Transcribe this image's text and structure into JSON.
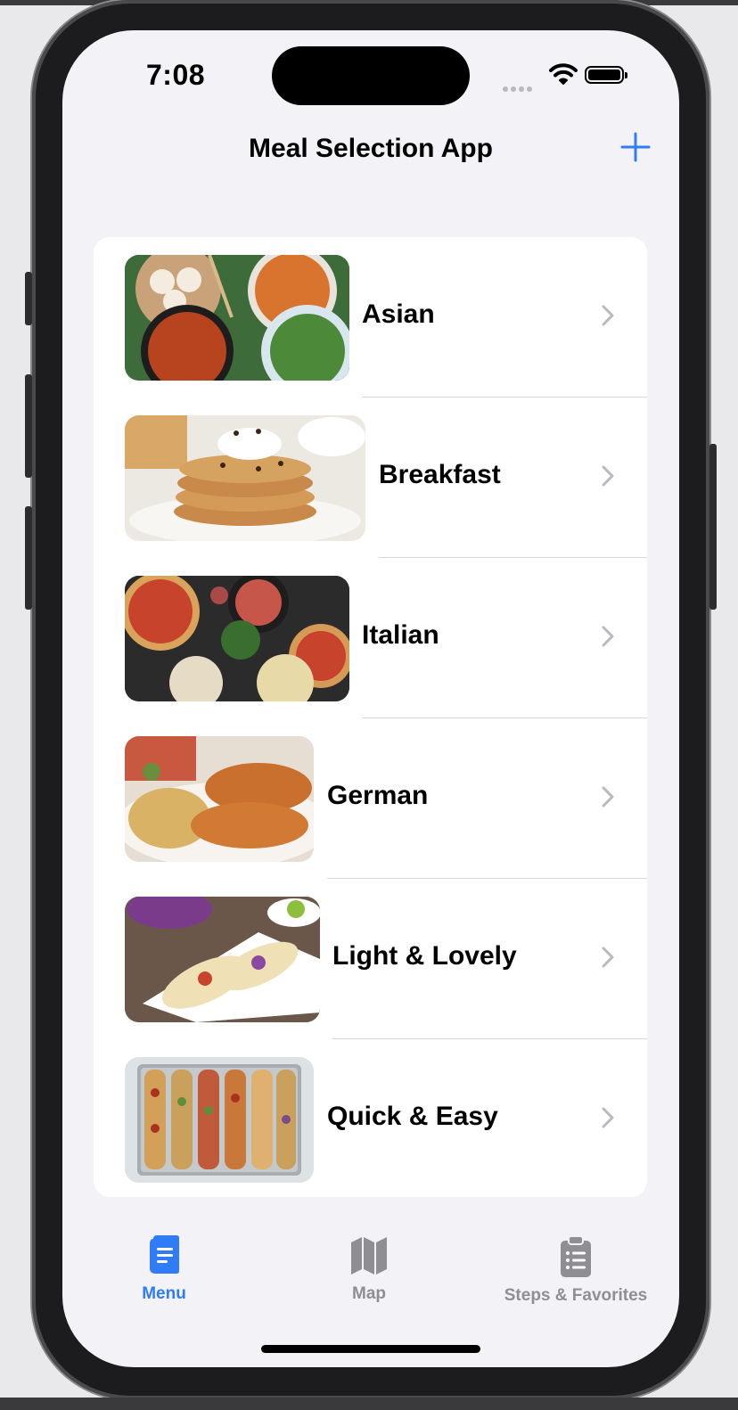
{
  "status_bar": {
    "time": "7:08"
  },
  "nav": {
    "title": "Meal Selection App",
    "add_icon": "plus-icon"
  },
  "categories": [
    {
      "label": "Asian"
    },
    {
      "label": "Breakfast"
    },
    {
      "label": "Italian"
    },
    {
      "label": "German"
    },
    {
      "label": "Light & Lovely"
    },
    {
      "label": "Quick & Easy"
    }
  ],
  "tabs": [
    {
      "label": "Menu",
      "icon": "menu-book-icon",
      "selected": true
    },
    {
      "label": "Map",
      "icon": "map-icon",
      "selected": false
    },
    {
      "label": "Steps & Favorites",
      "icon": "clipboard-icon",
      "selected": false
    }
  ],
  "colors": {
    "accent": "#2f7cf6",
    "inactive": "#8e8e93",
    "chevron": "#b8b8bd"
  }
}
